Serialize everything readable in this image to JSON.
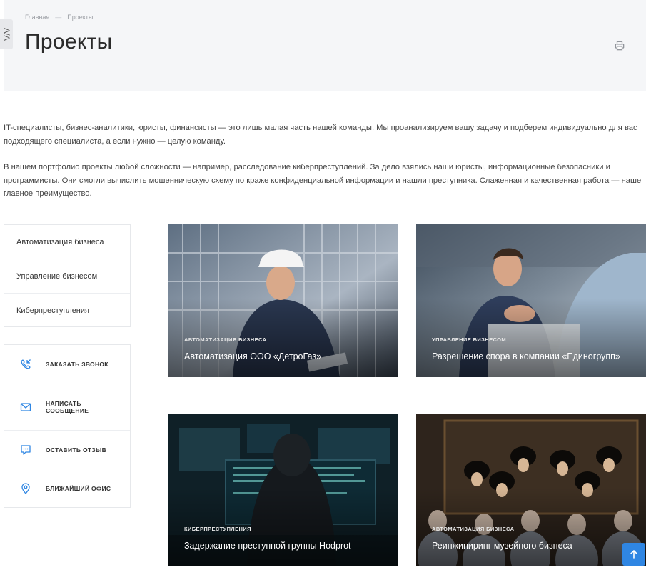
{
  "side_tab": {
    "label": "A/A"
  },
  "breadcrumb": {
    "home": "Главная",
    "separator": "—",
    "current": "Проекты"
  },
  "page": {
    "title": "Проекты"
  },
  "intro": {
    "paragraph1": "IT-специалисты, бизнес-аналитики, юристы, финансисты — это лишь малая часть нашей команды. Мы проанализируем вашу задачу и подберем индивидуально для вас подходящего специалиста, а если нужно — целую команду.",
    "paragraph2": "В нашем портфолио проекты любой сложности — например, расследование киберпреступлений. За дело взялись наши юристы, информационные безопасники и программисты. Они смогли вычислить мошенническую схему по краже конфиденциальной информации и нашли преступника. Слаженная и качественная работа — наше главное преимущество."
  },
  "categories": [
    {
      "label": "Автоматизация бизнеса"
    },
    {
      "label": "Управление бизнесом"
    },
    {
      "label": "Киберпреступления"
    }
  ],
  "actions": [
    {
      "label": "Заказать звонок",
      "icon": "phone-icon"
    },
    {
      "label": "Написать сообщение",
      "icon": "envelope-icon"
    },
    {
      "label": "Оставить отзыв",
      "icon": "chat-icon"
    },
    {
      "label": "Ближайший офис",
      "icon": "location-pin-icon"
    }
  ],
  "projects": [
    {
      "tag": "Автоматизация бизнеса",
      "title": "Автоматизация ООО «ДетроГаз»",
      "image": "engineer-in-hardhat"
    },
    {
      "tag": "Управление бизнесом",
      "title": "Разрешение спора в компании «Единогрупп»",
      "image": "business-handshake"
    },
    {
      "tag": "Киберпреступления",
      "title": "Задержание преступной группы Hodprot",
      "image": "hooded-hacker-monitors"
    },
    {
      "tag": "Автоматизация бизнеса",
      "title": "Реинжиниринг музейного бизнеса",
      "image": "museum-painting-visitors"
    }
  ],
  "colors": {
    "accent": "#2f86e3",
    "hero_bg": "#f5f6f8",
    "icon_blue": "#2f86e3"
  }
}
